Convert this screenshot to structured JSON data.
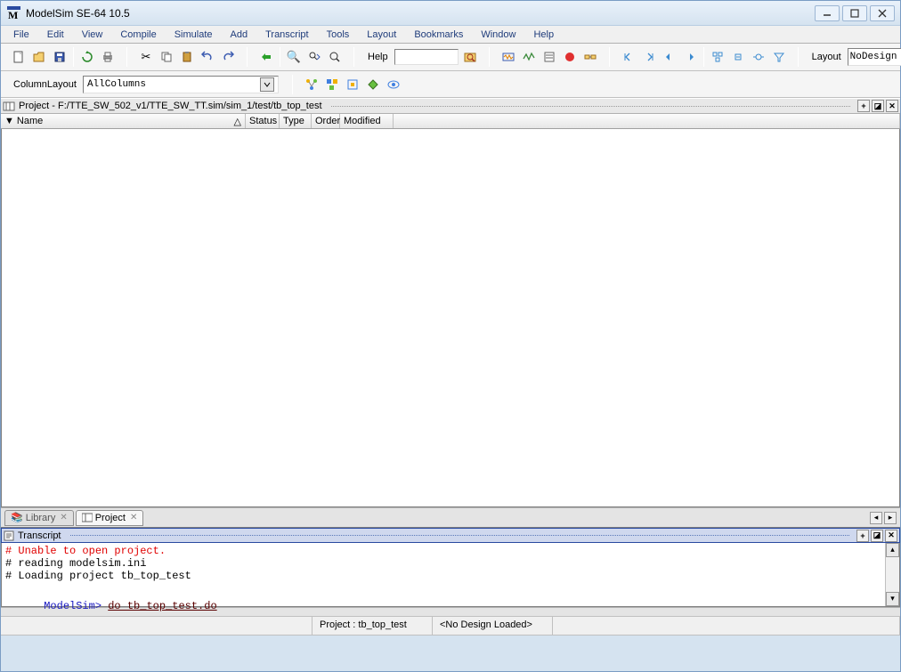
{
  "window": {
    "title": "ModelSim SE-64 10.5"
  },
  "menu": {
    "file": "File",
    "edit": "Edit",
    "view": "View",
    "compile": "Compile",
    "simulate": "Simulate",
    "add": "Add",
    "transcript": "Transcript",
    "tools": "Tools",
    "layout": "Layout",
    "bookmarks": "Bookmarks",
    "window": "Window",
    "help": "Help"
  },
  "toolbar": {
    "help_label": "Help",
    "help_value": "",
    "layout_label": "Layout",
    "layout_value": "NoDesign",
    "column_layout_label": "ColumnLayout",
    "column_layout_value": "AllColumns"
  },
  "project_panel": {
    "title": "Project - F:/TTE_SW_502_v1/TTE_SW_TT.sim/sim_1/test/tb_top_test",
    "columns": {
      "name": "Name",
      "status": "Status",
      "type": "Type",
      "order": "Order",
      "modified": "Modified"
    }
  },
  "tabs": {
    "library": "Library",
    "project": "Project"
  },
  "transcript": {
    "title": "Transcript",
    "lines": [
      {
        "text": "# Unable to open project.",
        "cls": "line-red"
      },
      {
        "text": "# reading modelsim.ini",
        "cls": ""
      },
      {
        "text": "# Loading project tb_top_test",
        "cls": ""
      }
    ],
    "prompt": "ModelSim>",
    "command": "do tb_top_test.do"
  },
  "statusbar": {
    "project": "Project : tb_top_test",
    "design": "<No Design Loaded>"
  }
}
